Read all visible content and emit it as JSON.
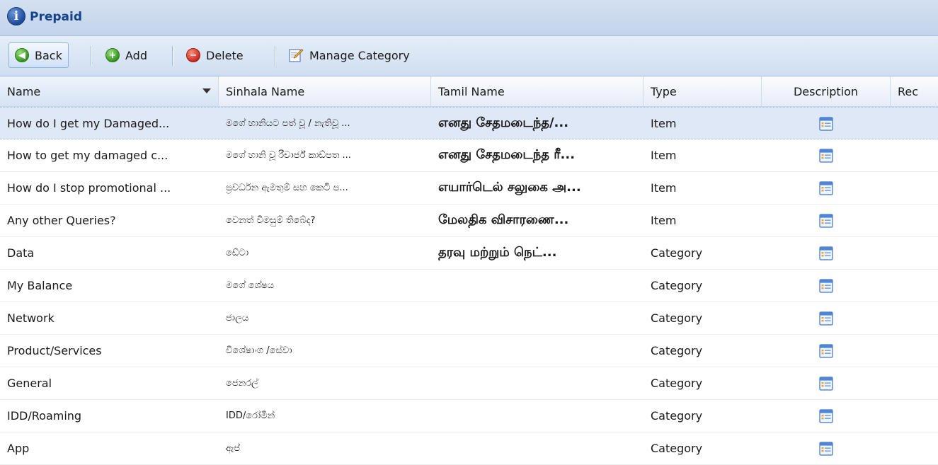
{
  "panel": {
    "title": "Prepaid"
  },
  "toolbar": {
    "back_label": "Back",
    "add_label": "Add",
    "delete_label": "Delete",
    "manage_label": "Manage Category"
  },
  "columns": {
    "name": "Name",
    "sinhala": "Sinhala Name",
    "tamil": "Tamil Name",
    "type": "Type",
    "description": "Description",
    "extra": "Rec"
  },
  "rows": [
    {
      "name": "How do I get my Damaged...",
      "sinhala": "මගේ හානියට පත් වූ / නැතිවූ ...",
      "tamil": "எனது சேதமடைந்த/...",
      "type": "Item",
      "selected": true
    },
    {
      "name": "How to get my damaged c...",
      "sinhala": "මගේ හානි වූ රීචාර්ජ් කාඩ්පත ...",
      "tamil": "எனது சேதமடைந்த ரீ...",
      "type": "Item"
    },
    {
      "name": "How do I stop promotional ...",
      "sinhala": "ප්‍රවර්ධන ඇමතුම් සහ කෙටි ප...",
      "tamil": "எயார்டெல் சலுகை அ...",
      "type": "Item"
    },
    {
      "name": "Any other Queries?",
      "sinhala": "වෙනත් විමසුම් තිබේද?",
      "tamil": "மேலதிக விசாரணை...",
      "type": "Item"
    },
    {
      "name": "Data",
      "sinhala": "ඩේටා",
      "tamil": "தரவு மற்றும் நெட்...",
      "type": "Category"
    },
    {
      "name": "My Balance",
      "sinhala": "මගේ ශේෂය",
      "tamil": "",
      "type": "Category"
    },
    {
      "name": "Network",
      "sinhala": "ජාලය",
      "tamil": "",
      "type": "Category"
    },
    {
      "name": "Product/Services",
      "sinhala": "විශේෂාංග /සේවා",
      "tamil": "",
      "type": "Category"
    },
    {
      "name": "General",
      "sinhala": "ජෙනරල්",
      "tamil": "",
      "type": "Category"
    },
    {
      "name": "IDD/Roaming",
      "sinhala": "IDD/රෝමින්",
      "tamil": "",
      "type": "Category"
    },
    {
      "name": "App",
      "sinhala": "ඇප්",
      "tamil": "",
      "type": "Category"
    }
  ],
  "icons": {
    "title": "info-icon",
    "back": "back-arrow-icon",
    "add": "add-icon",
    "delete": "delete-icon",
    "manage": "edit-pencil-icon",
    "description": "form-window-icon"
  },
  "colors": {
    "title_text": "#15428b",
    "selected_row": "#dfe8f6",
    "header_border": "#99bbe8"
  }
}
